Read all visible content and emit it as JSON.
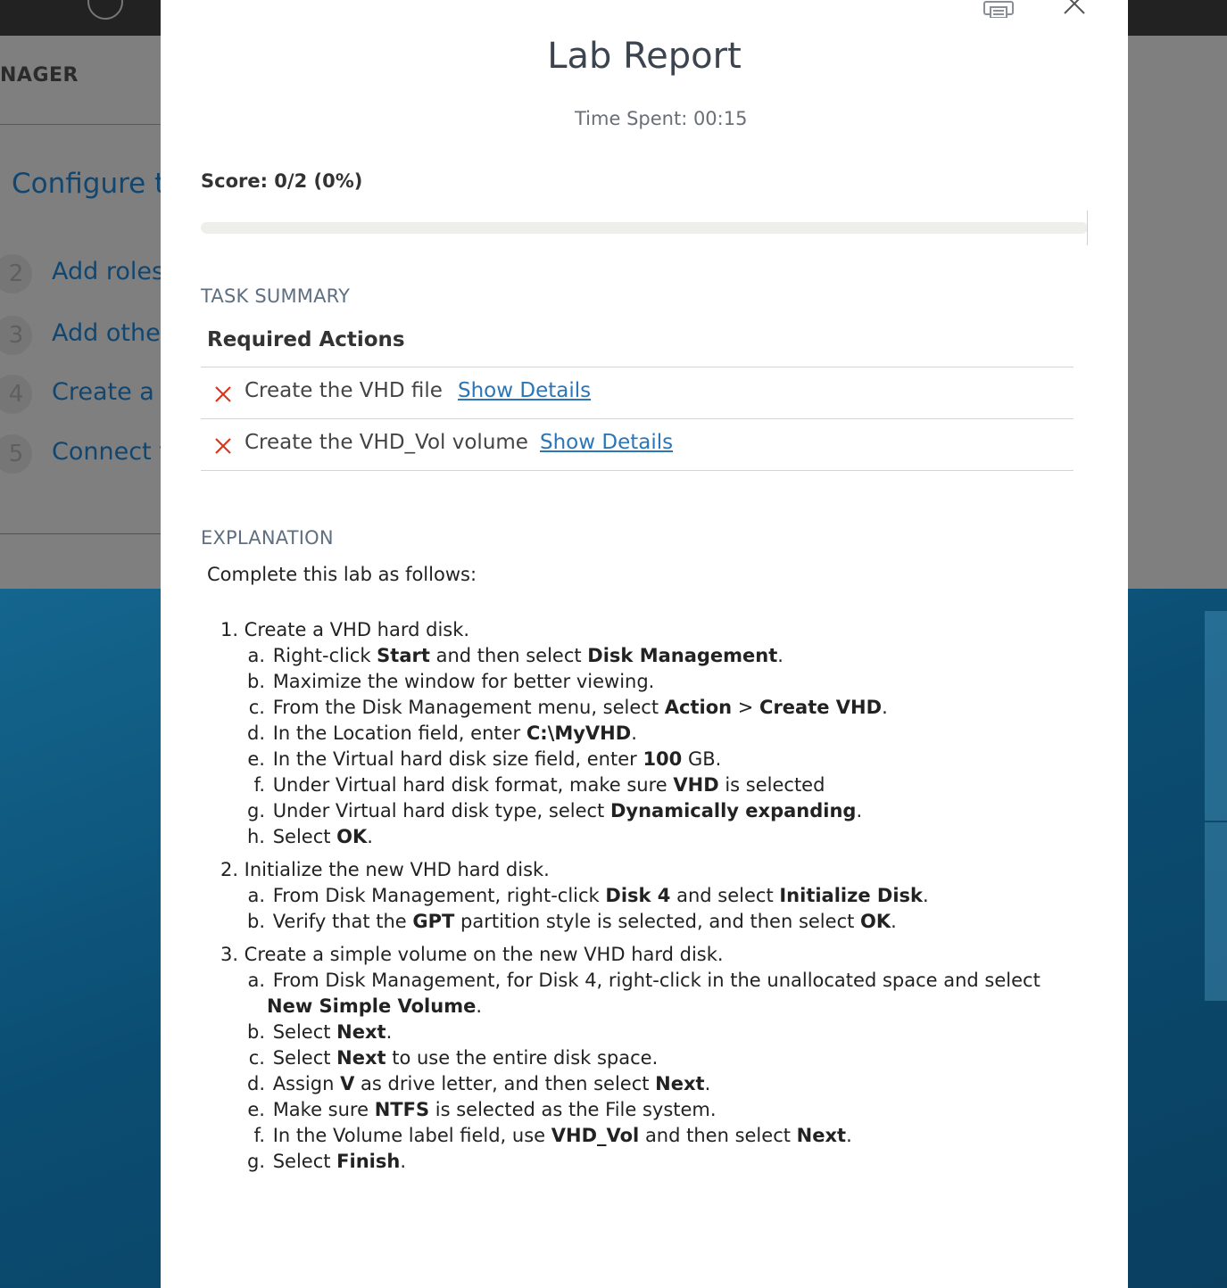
{
  "background": {
    "manager_label": "NAGER",
    "page_title": "Configure th",
    "steps": [
      {
        "num": "2",
        "label": "Add roles a"
      },
      {
        "num": "3",
        "label": "Add other"
      },
      {
        "num": "4",
        "label": "Create a s"
      },
      {
        "num": "5",
        "label": "Connect th"
      }
    ]
  },
  "modal": {
    "title": "Lab Report",
    "time_spent": "Time Spent: 00:15",
    "score": "Score: 0/2 (0%)",
    "score_fraction": 0,
    "task_summary_heading": "TASK SUMMARY",
    "required_actions_heading": "Required Actions",
    "tasks": [
      {
        "status": "failed",
        "name": "Create the VHD file",
        "link": "Show Details"
      },
      {
        "status": "failed",
        "name": "Create the VHD_Vol volume",
        "link": "Show Details"
      }
    ],
    "explanation_heading": "EXPLANATION",
    "explanation_intro": "Complete this lab as follows:",
    "steps": [
      {
        "num": "1.",
        "text": "Create a VHD hard disk.",
        "subs": [
          {
            "l": "a.",
            "parts": [
              [
                "Right-click ",
                false
              ],
              [
                "Start",
                true
              ],
              [
                " and then select ",
                false
              ],
              [
                "Disk Management",
                true
              ],
              [
                ".",
                false
              ]
            ]
          },
          {
            "l": "b.",
            "parts": [
              [
                "Maximize the window for better viewing.",
                false
              ]
            ]
          },
          {
            "l": "c.",
            "parts": [
              [
                "From the Disk Management menu, select ",
                false
              ],
              [
                "Action",
                true
              ],
              [
                " > ",
                false
              ],
              [
                "Create VHD",
                true
              ],
              [
                ".",
                false
              ]
            ]
          },
          {
            "l": "d.",
            "parts": [
              [
                "In the Location field, enter ",
                false
              ],
              [
                "C:\\MyVHD",
                true
              ],
              [
                ".",
                false
              ]
            ]
          },
          {
            "l": "e.",
            "parts": [
              [
                "In the Virtual hard disk size field, enter ",
                false
              ],
              [
                "100",
                true
              ],
              [
                " GB.",
                false
              ]
            ]
          },
          {
            "l": "f.",
            "parts": [
              [
                "Under Virtual hard disk format, make sure ",
                false
              ],
              [
                "VHD",
                true
              ],
              [
                " is selected",
                false
              ]
            ]
          },
          {
            "l": "g.",
            "parts": [
              [
                "Under Virtual hard disk type, select ",
                false
              ],
              [
                "Dynamically expanding",
                true
              ],
              [
                ".",
                false
              ]
            ]
          },
          {
            "l": "h.",
            "parts": [
              [
                "Select ",
                false
              ],
              [
                "OK",
                true
              ],
              [
                ".",
                false
              ]
            ]
          }
        ]
      },
      {
        "num": "2.",
        "text": "Initialize the new VHD hard disk.",
        "subs": [
          {
            "l": "a.",
            "parts": [
              [
                "From Disk Management, right-click ",
                false
              ],
              [
                "Disk 4",
                true
              ],
              [
                " and select ",
                false
              ],
              [
                "Initialize Disk",
                true
              ],
              [
                ".",
                false
              ]
            ]
          },
          {
            "l": "b.",
            "parts": [
              [
                "Verify that the ",
                false
              ],
              [
                "GPT",
                true
              ],
              [
                " partition style is selected, and then select ",
                false
              ],
              [
                "OK",
                true
              ],
              [
                ".",
                false
              ]
            ]
          }
        ]
      },
      {
        "num": "3.",
        "text": "Create a simple volume on the new VHD hard disk.",
        "subs": [
          {
            "l": "a.",
            "parts": [
              [
                "From Disk Management, for Disk 4, right-click in the unallocated space and select ",
                false
              ],
              [
                "New Simple Volume",
                true
              ],
              [
                ".",
                false
              ]
            ]
          },
          {
            "l": "b.",
            "parts": [
              [
                "Select ",
                false
              ],
              [
                "Next",
                true
              ],
              [
                ".",
                false
              ]
            ]
          },
          {
            "l": "c.",
            "parts": [
              [
                "Select ",
                false
              ],
              [
                "Next",
                true
              ],
              [
                " to use the entire disk space.",
                false
              ]
            ]
          },
          {
            "l": "d.",
            "parts": [
              [
                "Assign ",
                false
              ],
              [
                "V",
                true
              ],
              [
                " as drive letter, and then select ",
                false
              ],
              [
                "Next",
                true
              ],
              [
                ".",
                false
              ]
            ]
          },
          {
            "l": "e.",
            "parts": [
              [
                "Make sure ",
                false
              ],
              [
                "NTFS",
                true
              ],
              [
                " is selected as the File system.",
                false
              ]
            ]
          },
          {
            "l": "f.",
            "parts": [
              [
                "In the Volume label field, use ",
                false
              ],
              [
                "VHD_Vol",
                true
              ],
              [
                " and then select ",
                false
              ],
              [
                "Next",
                true
              ],
              [
                ".",
                false
              ]
            ]
          },
          {
            "l": "g.",
            "parts": [
              [
                "Select ",
                false
              ],
              [
                "Finish",
                true
              ],
              [
                ".",
                false
              ]
            ]
          }
        ]
      }
    ]
  },
  "colors": {
    "fail": "#d9341c",
    "link": "#2a76b8",
    "app_accent": "#10466f"
  }
}
